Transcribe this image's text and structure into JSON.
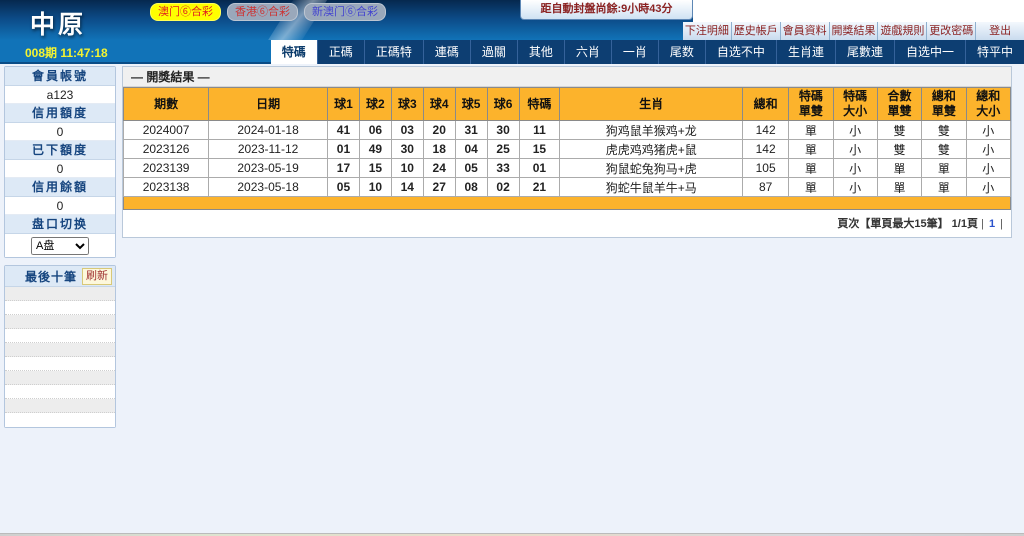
{
  "header": {
    "logo": "中原",
    "lottery_tags": [
      {
        "label": "澳门⑥合彩",
        "active": true,
        "bg": "#ffff00",
        "color": "#e02020"
      },
      {
        "label": "香港⑥合彩",
        "active": false,
        "bg": "#9aa8bb",
        "color": "#cc3333"
      },
      {
        "label": "新澳门⑥合彩",
        "active": false,
        "bg": "#9aa8bb",
        "color": "#4343cf"
      }
    ],
    "countdown": "距自動封盤尚餘:9小時43分",
    "nav_links": [
      "下注明細",
      "歷史帳戶",
      "會員資料",
      "開獎結果",
      "遊戲規則",
      "更改密碼",
      "登出"
    ],
    "period_time": "008期 11:47:18"
  },
  "tabs": [
    {
      "label": "特碼",
      "active": true
    },
    {
      "label": "正碼",
      "active": false
    },
    {
      "label": "正碼特",
      "active": false
    },
    {
      "label": "連碼",
      "active": false
    },
    {
      "label": "過關",
      "active": false
    },
    {
      "label": "其他",
      "active": false
    },
    {
      "label": "六肖",
      "active": false
    },
    {
      "label": "一肖",
      "active": false
    },
    {
      "label": "尾数",
      "active": false
    },
    {
      "label": "自选不中",
      "active": false
    },
    {
      "label": "生肖連",
      "active": false
    },
    {
      "label": "尾數連",
      "active": false
    },
    {
      "label": "自选中一",
      "active": false
    },
    {
      "label": "特平中",
      "active": false
    }
  ],
  "sidebar": {
    "account_fields": [
      {
        "label": "會員帳號",
        "value": "a123"
      },
      {
        "label": "信用額度",
        "value": "0"
      },
      {
        "label": "已下額度",
        "value": "0"
      },
      {
        "label": "信用餘額",
        "value": "0"
      }
    ],
    "panel_switch_label": "盘口切换",
    "panel_switch_value": "A盘",
    "last_bets": {
      "title": "最後十筆",
      "refresh_label": "刷新",
      "empty_row_count": 10
    }
  },
  "results": {
    "title": "— 開獎結果 —",
    "columns": [
      "期數",
      "日期",
      "球1",
      "球2",
      "球3",
      "球4",
      "球5",
      "球6",
      "特碼",
      "生肖",
      "總和",
      "特碼\n單雙",
      "特碼\n大小",
      "合數\n單雙",
      "總和\n單雙",
      "總和\n大小"
    ],
    "column_widths": [
      "9.6%",
      "13.4%",
      "3.6%",
      "3.6%",
      "3.6%",
      "3.6%",
      "3.6%",
      "3.6%",
      "4.6%",
      "20.6%",
      "5.2%",
      "5%",
      "5%",
      "5%",
      "5%",
      "5%"
    ],
    "rows": [
      {
        "period": "2024007",
        "date": "2024-01-18",
        "balls": [
          {
            "n": "41",
            "c": "b"
          },
          {
            "n": "06",
            "c": "g"
          },
          {
            "n": "03",
            "c": "b"
          },
          {
            "n": "20",
            "c": "b"
          },
          {
            "n": "31",
            "c": "b"
          },
          {
            "n": "30",
            "c": "r"
          }
        ],
        "special": {
          "n": "11",
          "c": "g"
        },
        "zodiac": "狗鸡鼠羊猴鸡+龙",
        "total": "142",
        "attrs": [
          "單",
          "小",
          "雙",
          "雙",
          "小"
        ]
      },
      {
        "period": "2023126",
        "date": "2023-11-12",
        "balls": [
          {
            "n": "01",
            "c": "r"
          },
          {
            "n": "49",
            "c": "g"
          },
          {
            "n": "30",
            "c": "r"
          },
          {
            "n": "18",
            "c": "r"
          },
          {
            "n": "04",
            "c": "b"
          },
          {
            "n": "25",
            "c": "b"
          }
        ],
        "special": {
          "n": "15",
          "c": "b"
        },
        "zodiac": "虎虎鸡鸡猪虎+鼠",
        "total": "142",
        "attrs": [
          "單",
          "小",
          "雙",
          "雙",
          "小"
        ]
      },
      {
        "period": "2023139",
        "date": "2023-05-19",
        "balls": [
          {
            "n": "17",
            "c": "g"
          },
          {
            "n": "15",
            "c": "b"
          },
          {
            "n": "10",
            "c": "b"
          },
          {
            "n": "24",
            "c": "r"
          },
          {
            "n": "05",
            "c": "g"
          },
          {
            "n": "33",
            "c": "g"
          }
        ],
        "special": {
          "n": "01",
          "c": "r"
        },
        "zodiac": "狗鼠蛇兔狗马+虎",
        "total": "105",
        "attrs": [
          "單",
          "小",
          "單",
          "單",
          "小"
        ]
      },
      {
        "period": "2023138",
        "date": "2023-05-18",
        "balls": [
          {
            "n": "05",
            "c": "g"
          },
          {
            "n": "10",
            "c": "b"
          },
          {
            "n": "14",
            "c": "b"
          },
          {
            "n": "27",
            "c": "g"
          },
          {
            "n": "08",
            "c": "r"
          },
          {
            "n": "02",
            "c": "r"
          }
        ],
        "special": {
          "n": "21",
          "c": "g"
        },
        "zodiac": "狗蛇牛鼠羊牛+马",
        "total": "87",
        "attrs": [
          "單",
          "小",
          "單",
          "單",
          "小"
        ]
      }
    ],
    "paging": {
      "info": "頁次【單頁最大15筆】 1/1頁",
      "sep_left": "|",
      "page_link": "1",
      "sep_right": "|"
    }
  },
  "colors": {
    "ball_blue": "#3a3ad0",
    "ball_green": "#2ea22e",
    "ball_red": "#e03a3a",
    "table_header_orange": "#fcb32c",
    "header_navy": "#0d3e72",
    "accent_blue": "#1173b8"
  }
}
